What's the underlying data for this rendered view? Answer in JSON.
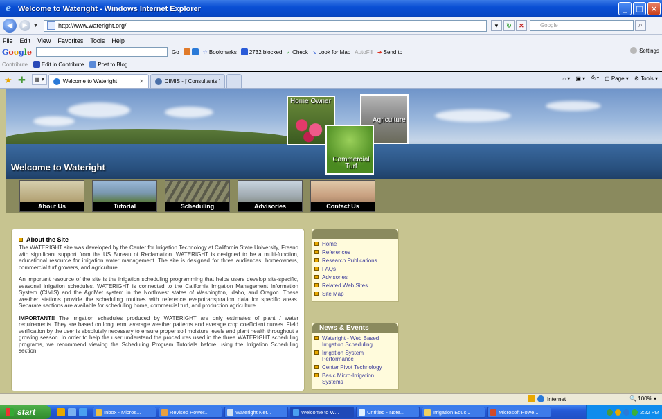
{
  "window": {
    "title": "Welcome to Wateright - Windows Internet Explorer"
  },
  "address": {
    "url": "http://www.wateright.org/",
    "search_placeholder": "Google"
  },
  "menu": [
    "File",
    "Edit",
    "View",
    "Favorites",
    "Tools",
    "Help"
  ],
  "google_toolbar": {
    "logo": "Google",
    "go": "Go",
    "bookmarks": "Bookmarks",
    "blocked": "2732 blocked",
    "check": "Check",
    "look_for_map": "Look for Map",
    "autofill": "AutoFill",
    "send_to": "Send to",
    "settings": "Settings"
  },
  "contribute_bar": {
    "contribute": "Contribute",
    "edit": "Edit in Contribute",
    "post": "Post to Blog"
  },
  "tabs": [
    {
      "label": "Welcome to Wateright",
      "active": true
    },
    {
      "label": "CIMIS - [ Consultants ]",
      "active": false
    }
  ],
  "tab_tools": {
    "page": "Page",
    "tools": "Tools"
  },
  "banner": {
    "welcome": "Welcome to Wateright",
    "photos": {
      "home_owner": "Home Owner",
      "agriculture": "Agriculture",
      "commercial_turf": "Commercial Turf"
    }
  },
  "nav": [
    "About Us",
    "Tutorial",
    "Scheduling",
    "Advisories",
    "Contact Us"
  ],
  "about": {
    "heading": "About the Site",
    "p1": "The WATERIGHT site was developed by the Center for Irrigation Technology at California State University, Fresno with significant support from the US Bureau of Reclamation. WATERIGHT is designed to be a multi-function, educational resource for irrigation water management. The site is designed for three audiences: homeowners, commercial turf growers, and agriculture.",
    "p2": "An important resource of the site is the irrigation scheduling programming that helps users develop site-specific, seasonal irrigation schedules. WATERIGHT is connected to the California Irrigation Management Information System (CIMIS) and the AgriMet system in the Northwest states of Washington, Idaho, and Oregon. These weather stations provide the scheduling routines with reference evapotranspiration data for specific areas. Separate sections are available for scheduling home, commercial turf, and production agriculture.",
    "p3_bold": "IMPORTANT!!",
    "p3": " The irrigation schedules produced by WATERIGHT are only estimates of plant / water requirements. They are based on long term, average weather patterns and average crop coefficient curves. Field verification by the user is absolutely necessary to ensure proper soil moisture levels and plant health throughout a growing season. In order to help the user understand the procedures used in the three WATERIGHT scheduling programs, we recommend viewing the Scheduling Program Tutorials before using the Irrigation Scheduling section."
  },
  "links": [
    "Home",
    "References",
    "Research Publications",
    "FAQs",
    "Advisories",
    "Related Web Sites",
    "Site Map"
  ],
  "news": {
    "heading": "News & Events",
    "items": [
      "Wateright - Web Based Irrigation Scheduling",
      "Irrigation System Performance",
      "Center Pivot Technology",
      "Basic Micro-Irrigation Systems"
    ]
  },
  "status": {
    "zone": "Internet",
    "zoom": "100%"
  },
  "taskbar": {
    "start": "start",
    "tasks": [
      "Inbox - Micros...",
      "Revised Power...",
      "Wateright Net...",
      "Welcome to W...",
      "Untitled - Note...",
      "Irrigation Educ...",
      "Microsoft Powe..."
    ],
    "clock": "2:22 PM"
  }
}
